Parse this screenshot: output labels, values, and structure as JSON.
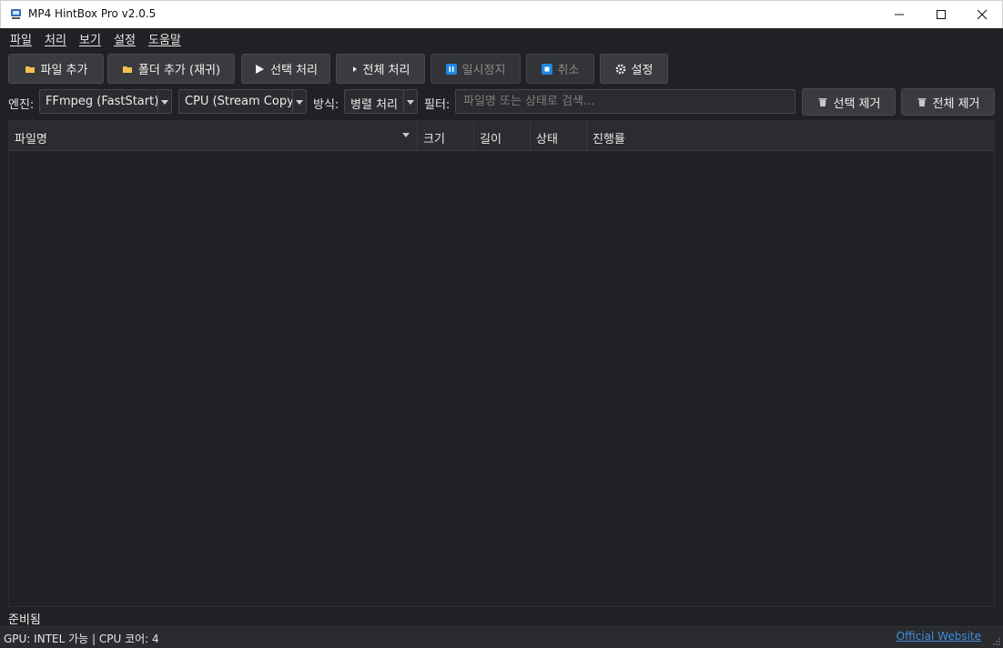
{
  "window": {
    "title": "MP4 HintBox Pro v2.0.5"
  },
  "menu": [
    "파일",
    "처리",
    "보기",
    "설정",
    "도움말"
  ],
  "toolbar": {
    "add_file": "파일 추가",
    "add_folder": "폴더 추가 (재귀)",
    "process_selected": "선택 처리",
    "process_all": "전체 처리",
    "pause": "일시정지",
    "cancel": "취소",
    "settings": "설정"
  },
  "filters": {
    "engine_label": "엔진:",
    "engine_value": "FFmpeg (FastStart)",
    "mode_value": "CPU (Stream Copy)",
    "method_label": "방식:",
    "method_value": "병렬 처리",
    "filter_label": "필터:",
    "search_placeholder": "파일명 또는 상태로 검색...",
    "remove_selected": "선택 제거",
    "remove_all": "전체 제거"
  },
  "table": {
    "columns": [
      "파일명",
      "크기",
      "길이",
      "상태",
      "진행률"
    ],
    "rows": []
  },
  "status": {
    "message": "준비됨",
    "info": "GPU: INTEL 가능 | CPU 코어: 4",
    "website": "Official Website"
  },
  "colors": {
    "background": "#202124",
    "button": "#3a3b3e",
    "link": "#3d8fe0",
    "folder_icon": "#f2c14e",
    "pause_icon": "#1e88e5"
  },
  "icons": {
    "app": "app-icon",
    "add_file": "folder-icon",
    "add_folder": "folder-icon",
    "process_selected": "play-icon",
    "process_all": "play-small-icon",
    "pause": "pause-icon",
    "cancel": "stop-icon",
    "settings": "gear-icon",
    "remove": "trash-icon"
  }
}
